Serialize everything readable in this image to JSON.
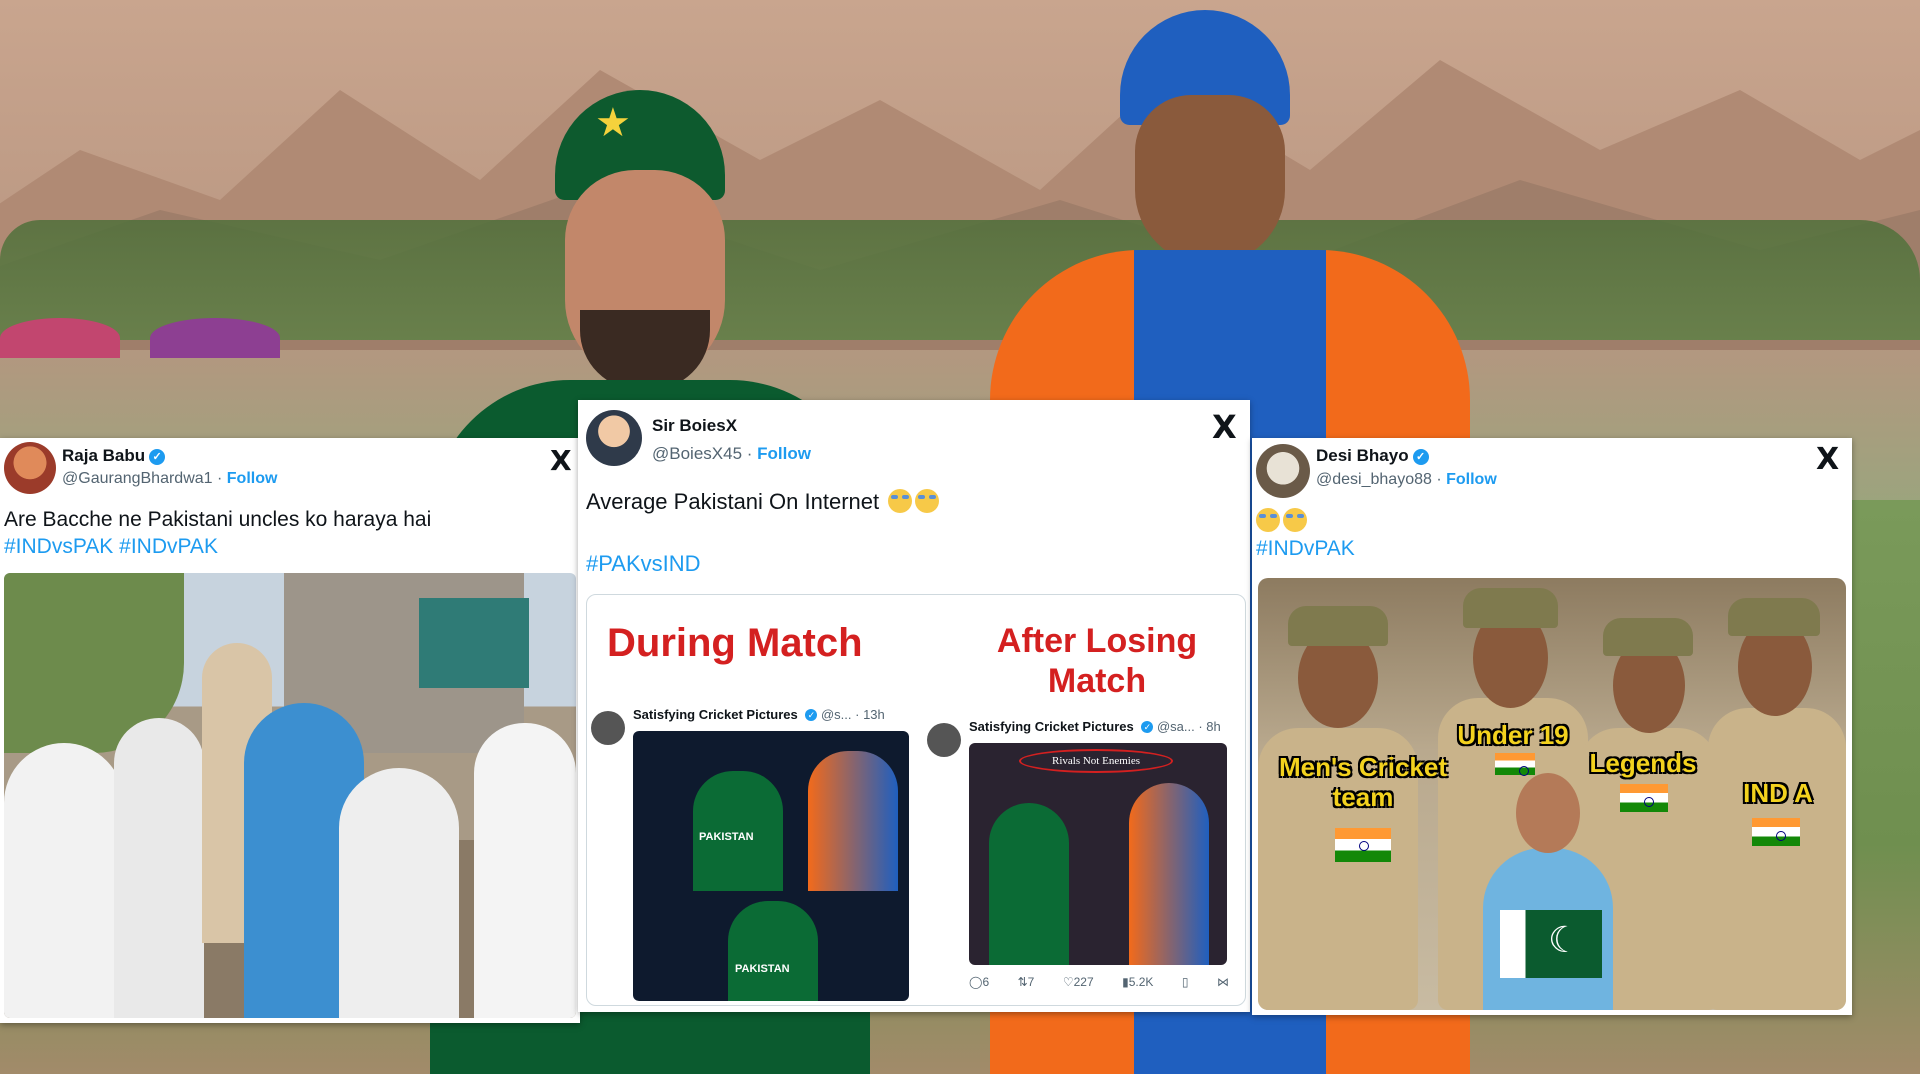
{
  "tweets": [
    {
      "name": "Raja Babu",
      "handle": "@GaurangBhardwa1 · ",
      "follow": "Follow",
      "text": "Are Bacche ne Pakistani uncles ko haraya hai",
      "hashtags": "#INDvsPAK #INDvPAK",
      "x_logo": "X"
    },
    {
      "name": "Sir BoiesX",
      "handle": "@BoiesX45 · ",
      "follow": "Follow",
      "text": "Average Pakistani On Internet",
      "hashtags": "#PAKvsIND",
      "x_logo": "X",
      "meme": {
        "left_title": "During Match",
        "right_title_1": "After Losing",
        "right_title_2": "Match",
        "inner_name": "Satisfying Cricket Pictures",
        "inner_handle_left": "@s... · 13h",
        "inner_handle_right": "@sa... · 8h",
        "jersey_text": "PAKISTAN",
        "jersey_text_2": "PAKISTAN",
        "caption": "Rivals Not Enemies",
        "stats": {
          "replies": "6",
          "retweets": "7",
          "likes": "227",
          "views": "5.2K"
        }
      }
    },
    {
      "name": "Desi Bhayo",
      "handle": "@desi_bhayo88 · ",
      "follow": "Follow",
      "text": "",
      "hashtags": "#INDvPAK",
      "x_logo": "X",
      "meme": {
        "label_1a": "Men's Cricket",
        "label_1b": "team",
        "label_2": "Under 19",
        "label_3": "Legends",
        "label_4": "IND A"
      }
    }
  ],
  "colors": {
    "accent": "#1d9bf0",
    "meme_red": "#d42020",
    "meme_yellow": "#f3d21e",
    "pak_green": "#0b5b2f",
    "ind_blue": "#1f5fbf",
    "ind_orange": "#f26a1b"
  },
  "icons": [
    "verified-badge-icon",
    "x-logo-icon",
    "reply-icon",
    "retweet-icon",
    "like-icon",
    "views-icon",
    "bookmark-icon",
    "share-icon"
  ]
}
